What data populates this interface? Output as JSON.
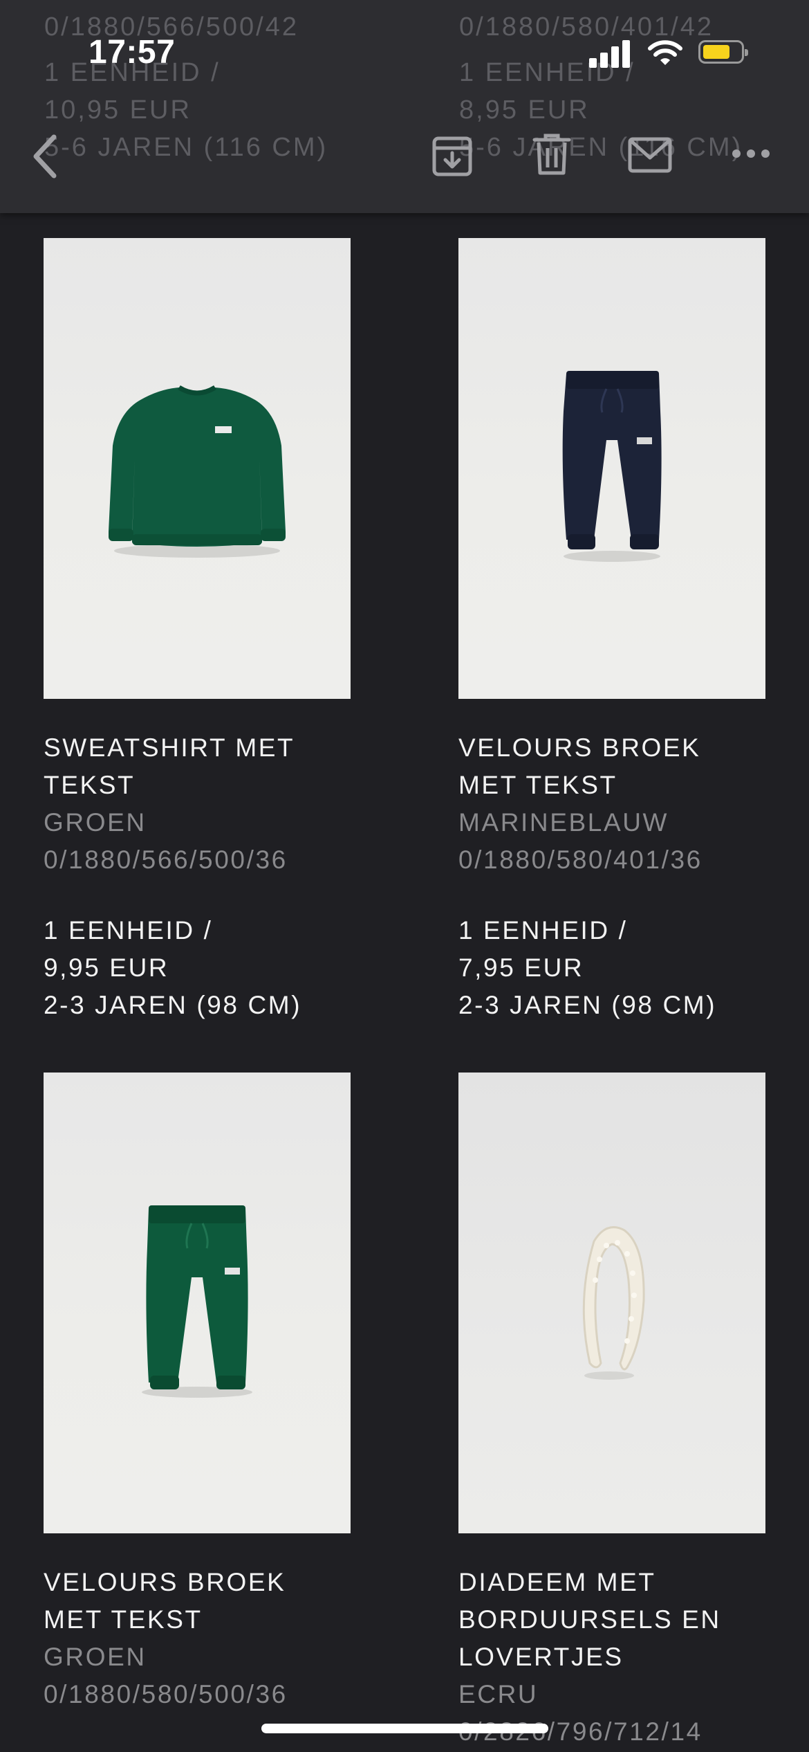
{
  "status_bar": {
    "time": "17:57",
    "icons": [
      "signal-icon",
      "wifi-icon",
      "battery-icon"
    ],
    "battery_color": "#f7d31d"
  },
  "background_peek": {
    "left": [
      "0/1880/566/500/42",
      "1 EENHEID /",
      "10,95 EUR",
      "5-6 JAREN (116 CM)"
    ],
    "right": [
      "0/1880/580/401/42",
      "1 EENHEID /",
      "8,95 EUR",
      "5-6 JAREN (116 CM)"
    ]
  },
  "toolbar": {
    "back": "chevron-left-icon",
    "actions": [
      "archive-icon",
      "trash-icon",
      "mail-icon",
      "more-icon"
    ]
  },
  "products": [
    {
      "title_line1": "SWEATSHIRT MET",
      "title_line2": "TEKST",
      "title_line3": "",
      "color": "GROEN",
      "reference": "0/1880/566/500/36",
      "quantity": "1 EENHEID /",
      "price": "9,95 EUR",
      "size": "2-3 JAREN (98 CM)",
      "image": "green-sweatshirt"
    },
    {
      "title_line1": "VELOURS BROEK",
      "title_line2": "MET TEKST",
      "title_line3": "",
      "color": "MARINEBLAUW",
      "reference": "0/1880/580/401/36",
      "quantity": "1 EENHEID /",
      "price": "7,95 EUR",
      "size": "2-3 JAREN (98 CM)",
      "image": "navy-jogger-pants"
    },
    {
      "title_line1": "VELOURS BROEK",
      "title_line2": "MET TEKST",
      "title_line3": "",
      "color": "GROEN",
      "reference": "0/1880/580/500/36",
      "image": "green-jogger-pants"
    },
    {
      "title_line1": "DIADEEM MET",
      "title_line2": "BORDUURSELS EN",
      "title_line3": "LOVERTJES",
      "color": "ECRU",
      "reference": "0/2826/796/712/14",
      "image": "beaded-headband"
    }
  ]
}
